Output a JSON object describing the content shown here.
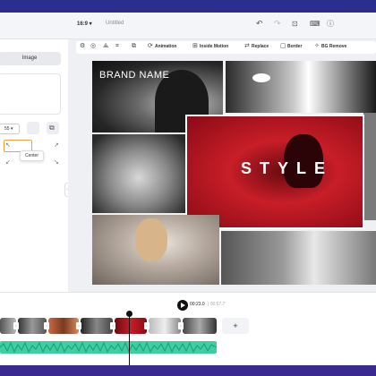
{
  "topbar": {
    "ratio": "16:9 ▾",
    "title": "Untitled"
  },
  "left": {
    "image_tab": "Image",
    "zoom": "55 ▾",
    "tooltip": "Center"
  },
  "toolbar": {
    "animation": "Animation",
    "inside_motion": "Inside Motion",
    "replace": "Replace",
    "border": "Border",
    "bg_remove": "BG Remove"
  },
  "canvas": {
    "brand": "BRAND NAME",
    "style": "STYLE"
  },
  "timeline": {
    "current": "00:23.0",
    "total": "| 00:57.7",
    "add": "+"
  },
  "colors": {
    "accent": "#f0a040",
    "audio": "#3ccfa2",
    "red_frame": "#c81e28"
  }
}
